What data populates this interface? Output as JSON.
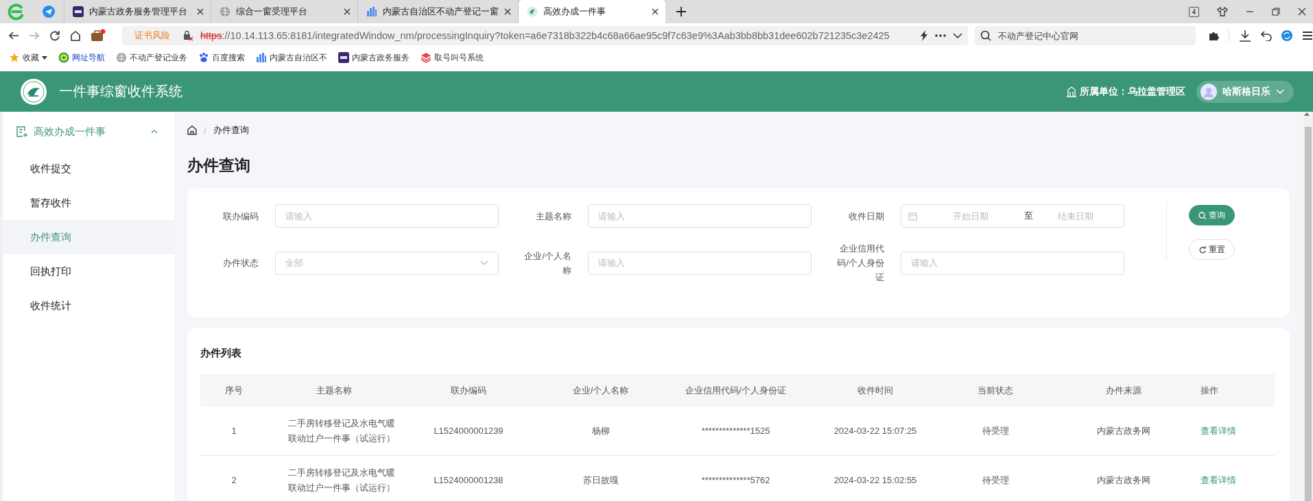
{
  "browser": {
    "tabs": [
      {
        "title": "内蒙古政务服务管理平台",
        "selected": false
      },
      {
        "title": "综合一窗受理平台",
        "selected": false
      },
      {
        "title": "内蒙古自治区不动产登记一窗",
        "selected": false
      },
      {
        "title": "高效办成一件事",
        "selected": true
      }
    ],
    "tab_count": "4",
    "address_bar": {
      "security_warning": "证书风险",
      "scheme": "https",
      "url": "://10.14.113.65:8181/integratedWindow_nm/processingInquiry?token=a6e7318b322b4c68a66ae95c9f7c63e9%3Aab3bb8bb31dee602b721235c3e2425"
    },
    "search": {
      "placeholder": "不动产登记中心官网"
    },
    "bookmarks": [
      {
        "label": "收藏",
        "kind": "menu"
      },
      {
        "label": "网址导航",
        "kind": "link"
      },
      {
        "label": "不动产登记业务",
        "kind": "link"
      },
      {
        "label": "百度搜索",
        "kind": "link"
      },
      {
        "label": "内蒙古自治区不",
        "kind": "link"
      },
      {
        "label": "内蒙古政务服务",
        "kind": "link"
      },
      {
        "label": "取号叫号系统",
        "kind": "link"
      }
    ]
  },
  "header": {
    "title": "一件事综窗收件系统",
    "unit": "所属单位：乌拉盖管理区",
    "user": "哈斯格日乐"
  },
  "sidebar": {
    "items": [
      {
        "label": "高效办成一件事",
        "expanded": true,
        "children": [
          {
            "label": "收件提交",
            "selected": false
          },
          {
            "label": "暂存收件",
            "selected": false
          },
          {
            "label": "办件查询",
            "selected": true
          },
          {
            "label": "回执打印",
            "selected": false
          },
          {
            "label": "收件统计",
            "selected": false
          }
        ]
      }
    ]
  },
  "breadcrumb": {
    "separator": "/",
    "current": "办件查询"
  },
  "page_title": "办件查询",
  "filters": {
    "fields": [
      {
        "label": "联办编码",
        "kind": "text",
        "placeholder": "请输入"
      },
      {
        "label": "主题名称",
        "kind": "text",
        "placeholder": "请输入"
      },
      {
        "label": "收件日期",
        "kind": "daterange",
        "start_placeholder": "开始日期",
        "separator": "至",
        "end_placeholder": "结束日期"
      },
      {
        "label": "办件状态",
        "kind": "select",
        "placeholder": "全部"
      },
      {
        "label": "企业/个人名称",
        "kind": "text",
        "placeholder": "请输入"
      },
      {
        "label": "企业信用代码/个人身份证",
        "kind": "text",
        "placeholder": "请输入"
      }
    ],
    "buttons": [
      {
        "label": "查询",
        "kind": "primary"
      },
      {
        "label": "重置",
        "kind": "default"
      }
    ]
  },
  "table": {
    "title": "办件列表",
    "columns": [
      "序号",
      "主题名称",
      "联办编码",
      "企业/个人名称",
      "企业信用代码/个人身份证",
      "收件时间",
      "当前状态",
      "办件来源",
      "操作"
    ],
    "rows": [
      {
        "cells": [
          "1",
          "二手房转移登记及水电气暖联动过户一件事（试运行）",
          "L1524000001239",
          "杨柳",
          "**************1525",
          "2024-03-22 15:07:25",
          "待受理",
          "内蒙古政务网"
        ],
        "action": "查看详情"
      },
      {
        "cells": [
          "2",
          "二手房转移登记及水电气暖联动过户一件事（试运行）",
          "L1524000001238",
          "苏日故嘎",
          "**************5762",
          "2024-03-22 15:02:55",
          "待受理",
          "内蒙古政务网"
        ],
        "action": "查看详情"
      }
    ]
  }
}
